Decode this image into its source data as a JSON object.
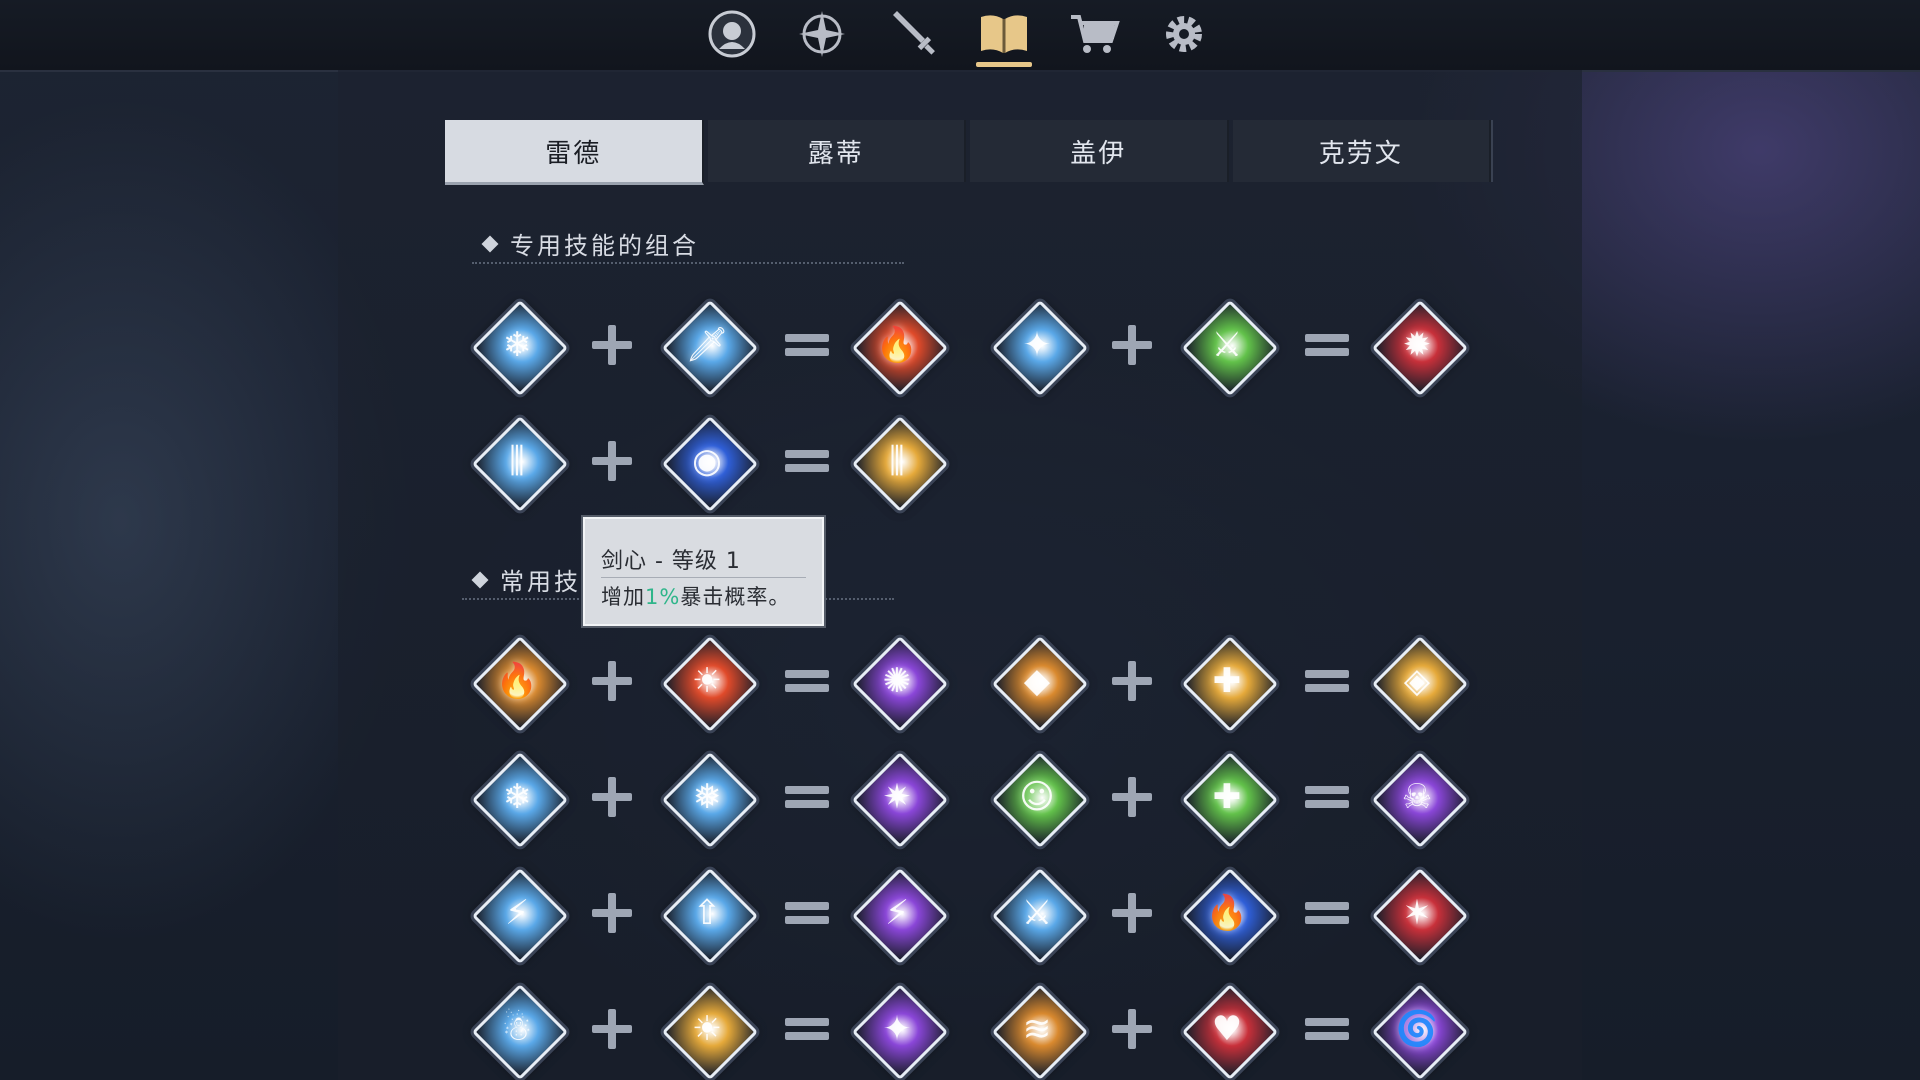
{
  "nav": {
    "items": [
      {
        "name": "character",
        "icon": "character-portrait-icon"
      },
      {
        "name": "skills",
        "icon": "compass-star-icon"
      },
      {
        "name": "equipment",
        "icon": "sword-icon"
      },
      {
        "name": "codex",
        "icon": "open-book-icon",
        "active": true
      },
      {
        "name": "shop",
        "icon": "shopping-cart-icon"
      },
      {
        "name": "settings",
        "icon": "gear-icon"
      }
    ],
    "accent": "#e7c789"
  },
  "tabs": [
    {
      "label": "雷德",
      "active": true
    },
    {
      "label": "露蒂",
      "active": false
    },
    {
      "label": "盖伊",
      "active": false
    },
    {
      "label": "克劳文",
      "active": false
    }
  ],
  "sections": {
    "exclusive_title": "专用技能的组合",
    "common_title": "常用技能的组合"
  },
  "tooltip": {
    "title": "剑心 - 等级 1",
    "desc_prefix": "增加",
    "desc_value": "1%",
    "desc_suffix": "暴击概率。"
  },
  "colors": {
    "ice": "#5aa8e8",
    "fire": "#e04a2a",
    "gold": "#e5a93a",
    "purple": "#8a46d8",
    "green": "#62c24a",
    "red": "#c8303a",
    "orange": "#d9892e",
    "blue": "#2f5fd8"
  },
  "combos": {
    "exclusive": [
      {
        "a": {
          "icon": "ice-blades-icon",
          "color": "ice",
          "glyph": "❄"
        },
        "b": {
          "icon": "ice-sword-icon",
          "color": "ice",
          "glyph": "🗡"
        },
        "r": {
          "icon": "flame-slash-icon",
          "color": "fire",
          "glyph": "🔥"
        }
      },
      {
        "a": {
          "icon": "ice-sword-burst-icon",
          "color": "ice",
          "glyph": "✦"
        },
        "b": {
          "icon": "green-sword-icon",
          "color": "green",
          "glyph": "⚔"
        },
        "r": {
          "icon": "crimson-burst-icon",
          "color": "red",
          "glyph": "✹"
        }
      },
      {
        "a": {
          "icon": "triple-blades-icon",
          "color": "ice",
          "glyph": "⫼"
        },
        "b": {
          "icon": "blue-vortex-icon",
          "color": "blue",
          "glyph": "◉"
        },
        "r": {
          "icon": "golden-claws-icon",
          "color": "gold",
          "glyph": "⫼"
        }
      }
    ],
    "common": [
      {
        "a": {
          "icon": "fire-orb-icon",
          "color": "orange",
          "glyph": "🔥"
        },
        "b": {
          "icon": "fire-spirit-icon",
          "color": "fire",
          "glyph": "☀"
        },
        "r": {
          "icon": "violet-flame-icon",
          "color": "purple",
          "glyph": "✺"
        }
      },
      {
        "a": {
          "icon": "rock-shield-icon",
          "color": "orange",
          "glyph": "◆"
        },
        "b": {
          "icon": "golden-cross-icon",
          "color": "gold",
          "glyph": "✚"
        },
        "r": {
          "icon": "gold-nugget-icon",
          "color": "gold",
          "glyph": "◈"
        }
      },
      {
        "a": {
          "icon": "ice-crystals-icon",
          "color": "ice",
          "glyph": "❄"
        },
        "b": {
          "icon": "snowflake-icon",
          "color": "ice",
          "glyph": "❅"
        },
        "r": {
          "icon": "amethyst-crystals-icon",
          "color": "purple",
          "glyph": "✷"
        }
      },
      {
        "a": {
          "icon": "green-spirit-icon",
          "color": "green",
          "glyph": "☺"
        },
        "b": {
          "icon": "healing-potion-icon",
          "color": "green",
          "glyph": "✚"
        },
        "r": {
          "icon": "poison-skull-icon",
          "color": "purple",
          "glyph": "☠"
        }
      },
      {
        "a": {
          "icon": "lightning-orb-icon",
          "color": "ice",
          "glyph": "⚡"
        },
        "b": {
          "icon": "lightning-arrow-icon",
          "color": "ice",
          "glyph": "⇧"
        },
        "r": {
          "icon": "storm-orb-icon",
          "color": "purple",
          "glyph": "⚡"
        }
      },
      {
        "a": {
          "icon": "ice-sword-strike-icon",
          "color": "ice",
          "glyph": "⚔"
        },
        "b": {
          "icon": "blue-flame-icon",
          "color": "blue",
          "glyph": "🔥"
        },
        "r": {
          "icon": "red-cracks-icon",
          "color": "red",
          "glyph": "✶"
        }
      },
      {
        "a": {
          "icon": "ice-spirit-icon",
          "color": "ice",
          "glyph": "☃"
        },
        "b": {
          "icon": "sun-spirit-icon",
          "color": "gold",
          "glyph": "☀"
        },
        "r": {
          "icon": "shadow-spirit-icon",
          "color": "purple",
          "glyph": "✦"
        }
      },
      {
        "a": {
          "icon": "orange-whirl-icon",
          "color": "orange",
          "glyph": "≋"
        },
        "b": {
          "icon": "red-heart-icon",
          "color": "red",
          "glyph": "♥"
        },
        "r": {
          "icon": "violet-tornado-icon",
          "color": "purple",
          "glyph": "🌀"
        }
      }
    ]
  }
}
